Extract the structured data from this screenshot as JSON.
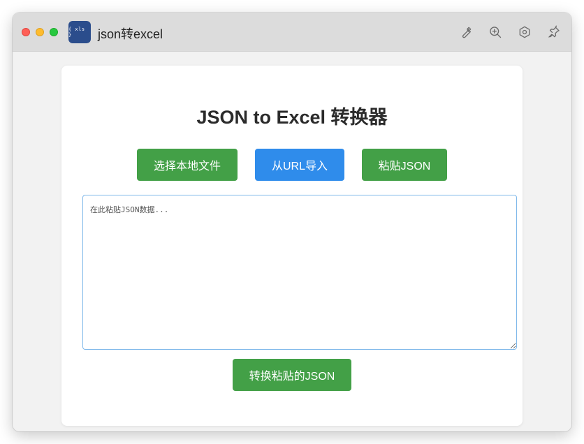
{
  "window": {
    "title": "json转excel",
    "app_icon_text": "{ xls }"
  },
  "toolbar": {
    "icons": [
      "wrench-icon",
      "zoom-in-icon",
      "hexagon-settings-icon",
      "pin-icon"
    ]
  },
  "main": {
    "heading": "JSON to Excel 转换器",
    "buttons": {
      "local_file": "选择本地文件",
      "url_import": "从URL导入",
      "paste_json": "粘贴JSON"
    },
    "textarea": {
      "placeholder": "在此粘贴JSON数据...",
      "value": ""
    },
    "convert_button": "转换粘贴的JSON"
  },
  "colors": {
    "green": "#43a047",
    "blue": "#2f8ceb",
    "app_icon_bg": "#2b4d8c"
  }
}
